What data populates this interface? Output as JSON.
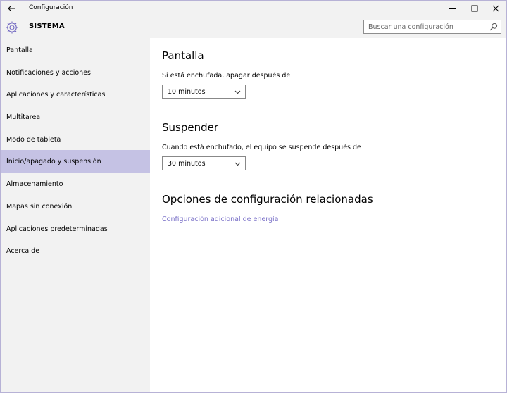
{
  "window": {
    "title": "Configuración",
    "controls": [
      "minimize",
      "maximize",
      "close"
    ]
  },
  "header": {
    "section_title": "SISTEMA",
    "icon": "gear-icon",
    "search": {
      "placeholder": "Buscar una configuración",
      "value": ""
    }
  },
  "sidebar": {
    "items": [
      {
        "label": "Pantalla",
        "selected": false
      },
      {
        "label": "Notificaciones y acciones",
        "selected": false
      },
      {
        "label": "Aplicaciones y características",
        "selected": false
      },
      {
        "label": "Multitarea",
        "selected": false
      },
      {
        "label": "Modo de tableta",
        "selected": false
      },
      {
        "label": "Inicio/apagado y suspensión",
        "selected": true
      },
      {
        "label": "Almacenamiento",
        "selected": false
      },
      {
        "label": "Mapas sin conexión",
        "selected": false
      },
      {
        "label": "Aplicaciones predeterminadas",
        "selected": false
      },
      {
        "label": "Acerca de",
        "selected": false
      }
    ]
  },
  "main": {
    "screen": {
      "heading": "Pantalla",
      "label": "Si está enchufada, apagar después de",
      "selected": "10 minutos"
    },
    "sleep": {
      "heading": "Suspender",
      "label": "Cuando está enchufado, el equipo se suspende después de",
      "selected": "30 minutos"
    },
    "related": {
      "heading": "Opciones de configuración relacionadas",
      "link": "Configuración adicional de energía"
    }
  },
  "colors": {
    "accent": "#7b72c8",
    "selected_bg": "#c5c2e4",
    "sidebar_bg": "#f2f2f2",
    "border": "#b7b2d6"
  }
}
